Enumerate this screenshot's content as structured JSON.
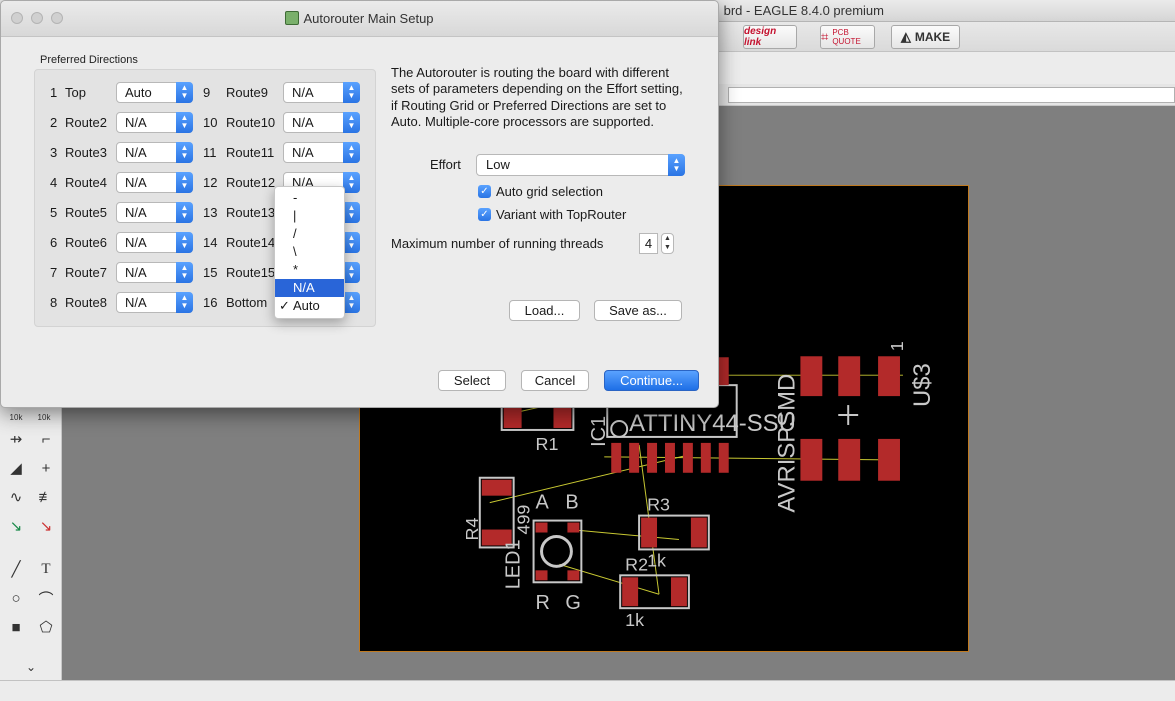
{
  "background_window": {
    "title": "...9 Boards/.../.../...d/Downloads/...t...brd - EAGLE 8.4.0 premium",
    "title_visible": "brd - EAGLE 8.4.0 premium",
    "toolbar": {
      "design_link": "design link",
      "pcb_quote": "PCB QUOTE",
      "make": "MAKE"
    }
  },
  "dialog": {
    "title": "Autorouter Main Setup",
    "preferred_directions_label": "Preferred Directions",
    "layers_left": [
      {
        "num": "1",
        "name": "Top",
        "value": "Auto"
      },
      {
        "num": "2",
        "name": "Route2",
        "value": "N/A"
      },
      {
        "num": "3",
        "name": "Route3",
        "value": "N/A"
      },
      {
        "num": "4",
        "name": "Route4",
        "value": "N/A"
      },
      {
        "num": "5",
        "name": "Route5",
        "value": "N/A"
      },
      {
        "num": "6",
        "name": "Route6",
        "value": "N/A"
      },
      {
        "num": "7",
        "name": "Route7",
        "value": "N/A"
      },
      {
        "num": "8",
        "name": "Route8",
        "value": "N/A"
      }
    ],
    "layers_right": [
      {
        "num": "9",
        "name": "Route9",
        "value": "N/A"
      },
      {
        "num": "10",
        "name": "Route10",
        "value": "N/A"
      },
      {
        "num": "11",
        "name": "Route11",
        "value": "N/A"
      },
      {
        "num": "12",
        "name": "Route12",
        "value": "N/A"
      },
      {
        "num": "13",
        "name": "Route13",
        "value": "N/A"
      },
      {
        "num": "14",
        "name": "Route14",
        "value": "N/A"
      },
      {
        "num": "15",
        "name": "Route15",
        "value": "N/A"
      },
      {
        "num": "16",
        "name": "Bottom",
        "value": "Auto"
      }
    ],
    "dropdown_options": [
      {
        "label": "-",
        "selected": false,
        "checked": false
      },
      {
        "label": "|",
        "selected": false,
        "checked": false
      },
      {
        "label": "/",
        "selected": false,
        "checked": false
      },
      {
        "label": "\\",
        "selected": false,
        "checked": false
      },
      {
        "label": "*",
        "selected": false,
        "checked": false
      },
      {
        "label": "N/A",
        "selected": true,
        "checked": false
      },
      {
        "label": "Auto",
        "selected": false,
        "checked": true
      }
    ],
    "description": "The Autorouter is routing the board with different sets of parameters depending on the Effort setting, if Routing Grid or Preferred Directions are set to Auto. Multiple-core processors are supported.",
    "effort_label": "Effort",
    "effort_value": "Low",
    "auto_grid_label": "Auto grid selection",
    "auto_grid_checked": true,
    "variant_label": "Variant with TopRouter",
    "variant_checked": true,
    "threads_label": "Maximum number of running threads",
    "threads_value": "4",
    "load_button": "Load...",
    "save_button": "Save as...",
    "select_button": "Select",
    "cancel_button": "Cancel",
    "continue_button": "Continue..."
  },
  "board_labels": {
    "r1": "R1",
    "r2": "R2",
    "r3": "R3",
    "r4": "R4",
    "r4_value": "499",
    "r2_value": "1k",
    "r3_value": "1k",
    "led": "LED1",
    "led_a": "A",
    "led_b": "B",
    "led_r": "R",
    "led_g": "G",
    "ic": "IC1",
    "attiny": "ATTINY44-SSU",
    "avrisp": "AVRISPSMD",
    "us3": "U$3",
    "pin1": "1"
  },
  "colors": {
    "accent": "#2a74e4",
    "pad": "#b32a2a",
    "board": "#000000",
    "silk": "#c8c8c8",
    "airwire": "#c8c832"
  }
}
